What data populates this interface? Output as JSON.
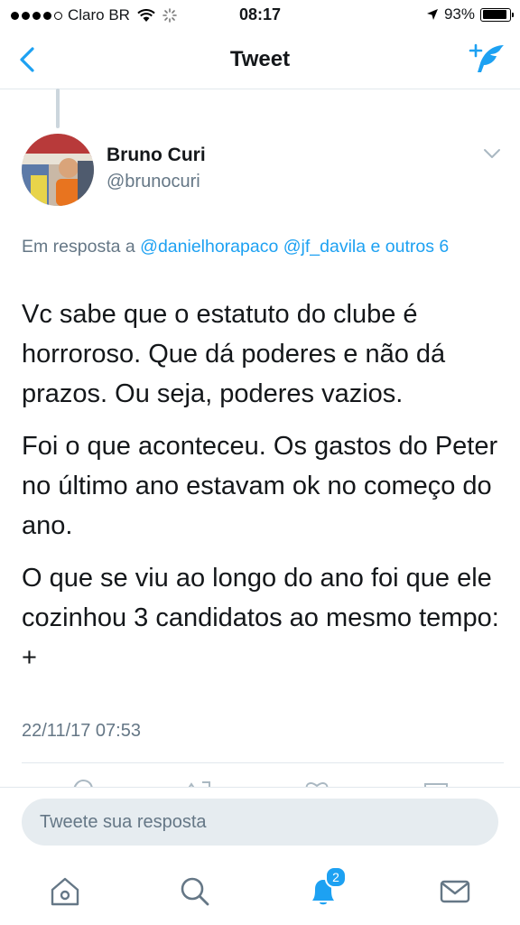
{
  "status_bar": {
    "carrier": "Claro BR",
    "time": "08:17",
    "battery_text": "93%",
    "battery_level": 0.93
  },
  "nav": {
    "title": "Tweet"
  },
  "tweet": {
    "author": {
      "name": "Bruno Curi",
      "handle": "@brunocuri"
    },
    "reply_to": {
      "prefix": "Em resposta a",
      "mention1": "@danielhorapaco",
      "mention2": "@jf_davila",
      "conj": "e",
      "others": "outros 6"
    },
    "paragraphs": [
      "Vc sabe que o estatuto do clube é horroroso. Que dá poderes e não dá prazos. Ou seja, poderes vazios.",
      "Foi o que aconteceu. Os gastos do Peter no último ano estavam ok no começo do ano.",
      "O que se viu ao longo do ano foi que ele cozinhou 3 candidatos ao mesmo tempo: +"
    ],
    "timestamp": "22/11/17 07:53"
  },
  "reply_box": {
    "placeholder": "Tweete sua resposta"
  },
  "tab_bar": {
    "notifications_badge": "2"
  },
  "colors": {
    "accent": "#1da1f2",
    "secondary_text": "#657786",
    "primary_text": "#14171a",
    "divider": "#e1e8ed"
  },
  "icons": {
    "back": "chevron-left-icon",
    "compose": "compose-tweet-icon",
    "caret": "chevron-down-icon",
    "home": "home-icon",
    "search": "search-icon",
    "notifications": "bell-icon",
    "messages": "envelope-icon"
  }
}
